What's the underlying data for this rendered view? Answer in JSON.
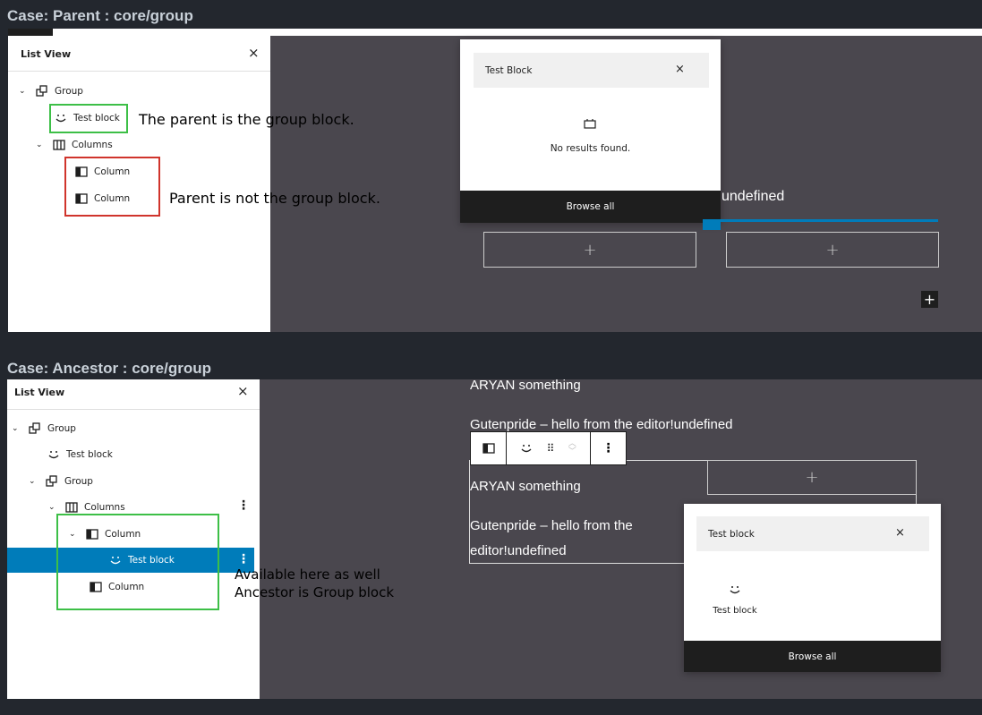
{
  "case1": {
    "title": "Case: Parent : core/group",
    "list_view": {
      "title": "List View",
      "close": "×",
      "items": [
        {
          "label": "Group",
          "icon": "group-icon"
        },
        {
          "label": "Test block",
          "icon": "smiley-icon"
        },
        {
          "label": "Columns",
          "icon": "columns-icon"
        },
        {
          "label": "Column",
          "icon": "column-icon"
        },
        {
          "label": "Column",
          "icon": "column-icon"
        }
      ]
    },
    "annotations": {
      "green": "The parent is the group block.",
      "red": "Parent is not the group block."
    },
    "inserter": {
      "search_value": "Test Block",
      "close": "×",
      "no_results": "No results found.",
      "browse_all": "Browse all"
    },
    "editor": {
      "text_undefined": "undefined",
      "appender_plus": "+",
      "add_button": "+"
    }
  },
  "case2": {
    "title": "Case: Ancestor : core/group",
    "list_view": {
      "title": "List View",
      "close": "×",
      "items": [
        {
          "label": "Group",
          "icon": "group-icon"
        },
        {
          "label": "Test block",
          "icon": "smiley-icon"
        },
        {
          "label": "Group",
          "icon": "group-icon"
        },
        {
          "label": "Columns",
          "icon": "columns-icon"
        },
        {
          "label": "Column",
          "icon": "column-icon"
        },
        {
          "label": "Test block",
          "icon": "smiley-icon"
        },
        {
          "label": "Column",
          "icon": "column-icon"
        }
      ]
    },
    "annotation": {
      "line1": "Available here as well",
      "line2": "Ancestor is Group block"
    },
    "editor": {
      "text1": "ARYAN something",
      "text2": "Gutenpride – hello from the editor!undefined",
      "text3": "ARYAN something",
      "text4a": "Gutenpride – hello from the",
      "text4b": "editor!undefined",
      "appender_plus": "+"
    },
    "inserter": {
      "search_value": "Test block",
      "close": "×",
      "result_label": "Test block",
      "browse_all": "Browse all"
    }
  },
  "colors": {
    "background": "#23272e",
    "editor_canvas": "#4a474e",
    "accent": "#007cba",
    "green_box": "#3dbf47",
    "red_box": "#d0342c"
  }
}
